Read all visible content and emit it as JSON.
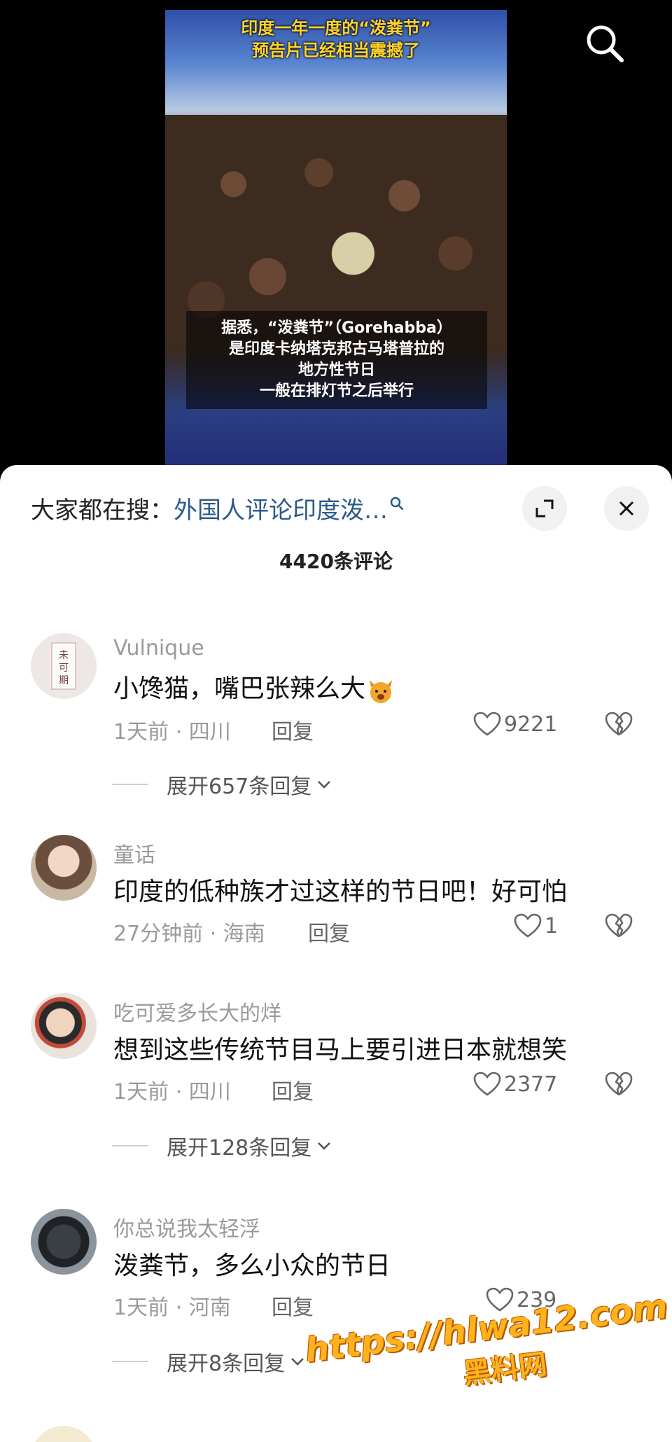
{
  "video": {
    "title_lines": [
      "印度一年一度的“泼粪节”",
      "预告片已经相当震撼了"
    ],
    "caption_lines": [
      "据悉，“泼粪节”（Gorehabba）",
      "是印度卡纳塔克邦古马塔普拉的",
      "地方性节日",
      "一般在排灯节之后举行"
    ],
    "search_icon": "search-icon"
  },
  "panel": {
    "hot_search_label": "大家都在搜：",
    "hot_search_term": "外国人评论印度泼…",
    "comment_count": "4420条评论"
  },
  "comments": [
    {
      "user": "Vulnique",
      "text": "小馋猫，嘴巴张辣么大",
      "emoji": "cat-face-icon",
      "meta": "1天前 · 四川",
      "reply": "回复",
      "likes": "9221",
      "expand": "展开657条回复"
    },
    {
      "user": "童话",
      "text": "印度的低种族才过这样的节日吧！好可怕",
      "meta": "27分钟前 · 海南",
      "reply": "回复",
      "likes": "1"
    },
    {
      "user": "吃可爱多长大的烊",
      "text": "想到这些传统节目马上要引进日本就想笑",
      "meta": "1天前 · 四川",
      "reply": "回复",
      "likes": "2377",
      "expand": "展开128条回复"
    },
    {
      "user": "你总说我太轻浮",
      "text": "泼粪节，多么小众的节日",
      "meta": "1天前 · 河南",
      "reply": "回复",
      "likes": "239",
      "expand": "展开8条回复"
    }
  ],
  "watermark": {
    "url": "https://hlwa12.com",
    "name": "黑料网"
  },
  "colors": {
    "accent_link": "#2a5a8c",
    "title_yellow": "#ffd42a",
    "watermark_orange": "#ffb21c"
  }
}
